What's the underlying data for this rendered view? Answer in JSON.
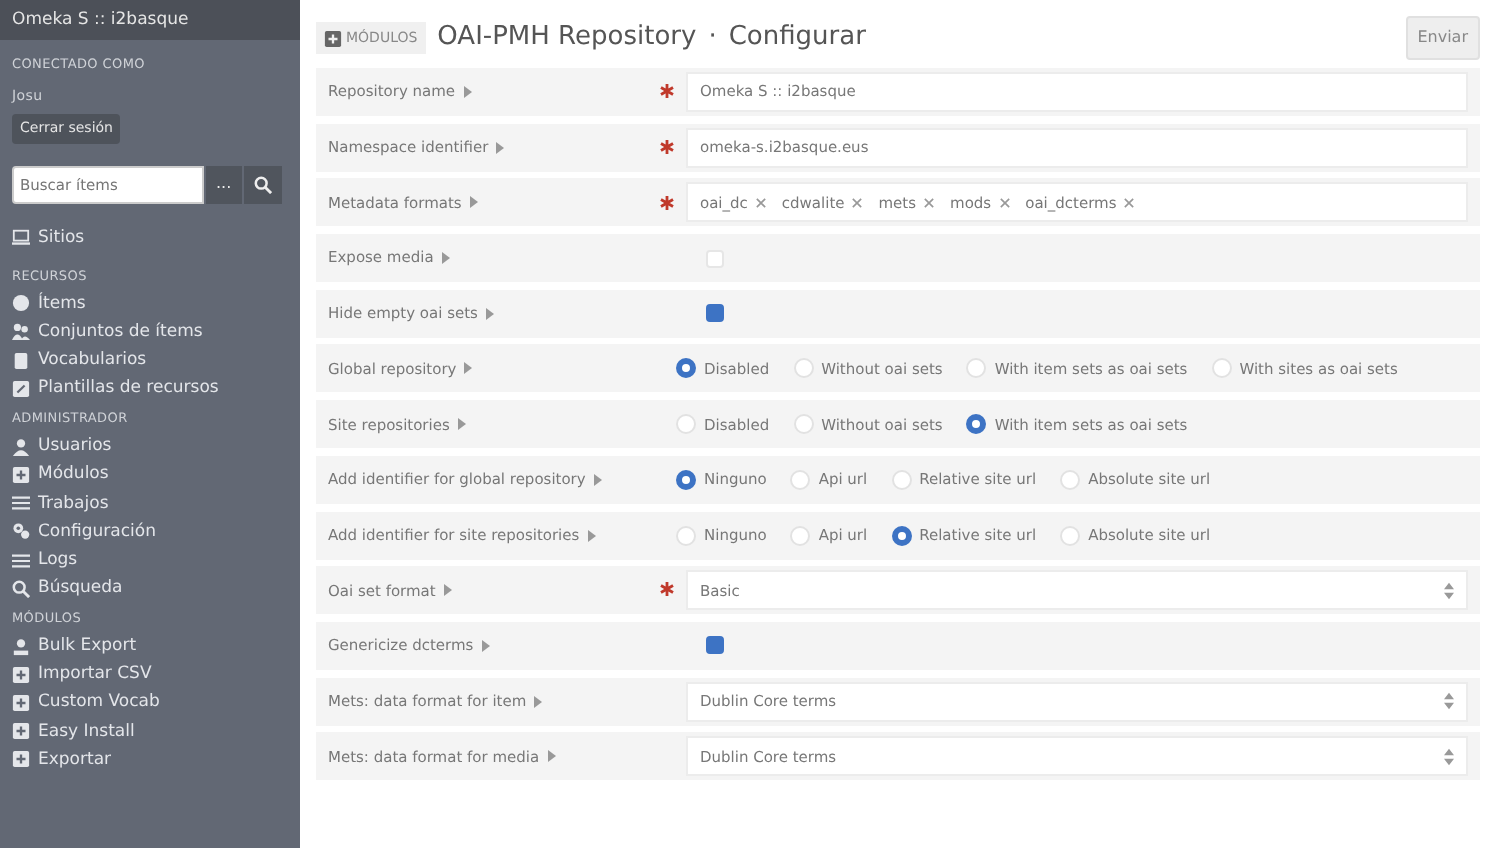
{
  "sidebar": {
    "site_title": "Omeka S :: i2basque",
    "logged_in_label": "CONECTADO COMO",
    "user": "Josu",
    "logout_button": "Cerrar sesión",
    "search": {
      "placeholder": "Buscar ítems",
      "options_button": "..."
    },
    "top_items": [
      {
        "label": "Sitios"
      }
    ],
    "sections": [
      {
        "heading": "RECURSOS",
        "items": [
          {
            "label": "Ítems"
          },
          {
            "label": "Conjuntos de ítems"
          },
          {
            "label": "Vocabularios"
          },
          {
            "label": "Plantillas de recursos"
          }
        ]
      },
      {
        "heading": "ADMINISTRADOR",
        "items": [
          {
            "label": "Usuarios"
          },
          {
            "label": "Módulos"
          },
          {
            "label": "Trabajos"
          },
          {
            "label": "Configuración"
          },
          {
            "label": "Logs"
          },
          {
            "label": "Búsqueda"
          }
        ]
      },
      {
        "heading": "MÓDULOS",
        "items": [
          {
            "label": "Bulk Export"
          },
          {
            "label": "Importar CSV"
          },
          {
            "label": "Custom Vocab"
          },
          {
            "label": "Easy Install"
          },
          {
            "label": "Exportar"
          }
        ]
      }
    ]
  },
  "header": {
    "breadcrumb": "MÓDULOS",
    "title": "OAI-PMH Repository",
    "separator": "·",
    "subtitle": "Configurar",
    "submit_button": "Enviar"
  },
  "fields": [
    {
      "kind": "text",
      "label": "Repository name",
      "required": true,
      "value": "Omeka S :: i2basque"
    },
    {
      "kind": "text",
      "label": "Namespace identifier",
      "required": true,
      "value": "omeka-s.i2basque.eus"
    },
    {
      "kind": "tags",
      "label": "Metadata formats",
      "required": true,
      "tags": [
        "oai_dc",
        "cdwalite",
        "mets",
        "mods",
        "oai_dcterms"
      ]
    },
    {
      "kind": "checkbox",
      "label": "Expose media",
      "required": false,
      "checked": false
    },
    {
      "kind": "checkbox",
      "label": "Hide empty oai sets",
      "required": false,
      "checked": true
    },
    {
      "kind": "radio",
      "label": "Global repository",
      "required": false,
      "options": [
        {
          "label": "Disabled",
          "selected": true
        },
        {
          "label": "Without oai sets",
          "selected": false
        },
        {
          "label": "With item sets as oai sets",
          "selected": false
        },
        {
          "label": "With sites as oai sets",
          "selected": false
        }
      ]
    },
    {
      "kind": "radio",
      "label": "Site repositories",
      "required": false,
      "options": [
        {
          "label": "Disabled",
          "selected": false
        },
        {
          "label": "Without oai sets",
          "selected": false
        },
        {
          "label": "With item sets as oai sets",
          "selected": true
        }
      ]
    },
    {
      "kind": "radio",
      "label": "Add identifier for global repository",
      "required": false,
      "options": [
        {
          "label": "Ninguno",
          "selected": true
        },
        {
          "label": "Api url",
          "selected": false
        },
        {
          "label": "Relative site url",
          "selected": false
        },
        {
          "label": "Absolute site url",
          "selected": false
        }
      ]
    },
    {
      "kind": "radio",
      "label": "Add identifier for site repositories",
      "required": false,
      "options": [
        {
          "label": "Ninguno",
          "selected": false
        },
        {
          "label": "Api url",
          "selected": false
        },
        {
          "label": "Relative site url",
          "selected": true
        },
        {
          "label": "Absolute site url",
          "selected": false
        }
      ]
    },
    {
      "kind": "select",
      "label": "Oai set format",
      "required": true,
      "value": "Basic"
    },
    {
      "kind": "checkbox",
      "label": "Genericize dcterms",
      "required": false,
      "checked": true
    },
    {
      "kind": "select",
      "label": "Mets: data format for item",
      "required": false,
      "value": "Dublin Core terms"
    },
    {
      "kind": "select",
      "label": "Mets: data format for media",
      "required": false,
      "value": "Dublin Core terms"
    }
  ]
}
